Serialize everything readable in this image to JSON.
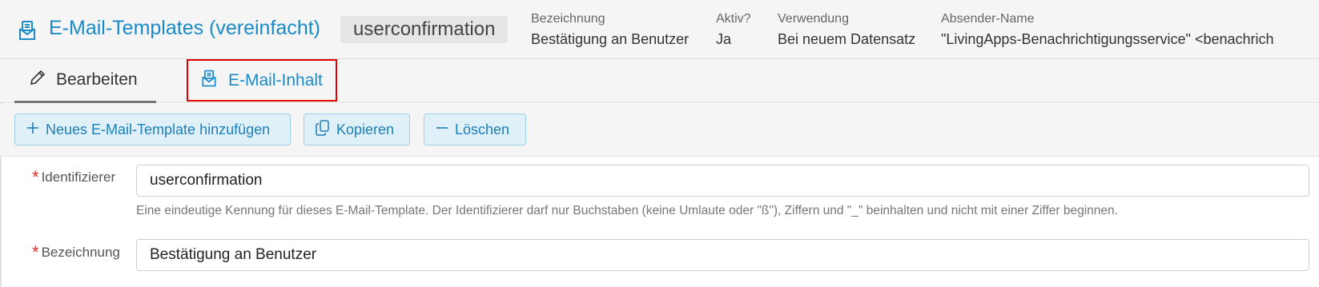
{
  "header": {
    "title": "E-Mail-Templates (vereinfacht)",
    "identifier_chip": "userconfirmation",
    "meta": [
      {
        "label": "Bezeichnung",
        "value": "Bestätigung an Benutzer"
      },
      {
        "label": "Aktiv?",
        "value": "Ja"
      },
      {
        "label": "Verwendung",
        "value": "Bei neuem Datensatz"
      },
      {
        "label": "Absender-Name",
        "value": "\"LivingApps-Benachrichtigungsservice\" <benachrich"
      }
    ]
  },
  "tabs": [
    {
      "label": "Bearbeiten",
      "icon": "pencil-icon"
    },
    {
      "label": "E-Mail-Inhalt",
      "icon": "mail-template-icon"
    }
  ],
  "toolbar": {
    "add_label": "Neues E-Mail-Template hinzufügen",
    "copy_label": "Kopieren",
    "delete_label": "Löschen"
  },
  "form": {
    "identifier": {
      "label": "Identifizierer",
      "value": "userconfirmation",
      "hint": "Eine eindeutige Kennung für dieses E-Mail-Template. Der Identifizierer darf nur Buchstaben (keine Umlaute oder \"ß\"), Ziffern und \"_\" beinhalten und nicht mit einer Ziffer beginnen."
    },
    "designation": {
      "label": "Bezeichnung",
      "value": "Bestätigung an Benutzer"
    },
    "required_marker": "*"
  },
  "colors": {
    "accent": "#1b8bc8",
    "required": "#d9302b",
    "highlight_border": "#e00000"
  }
}
